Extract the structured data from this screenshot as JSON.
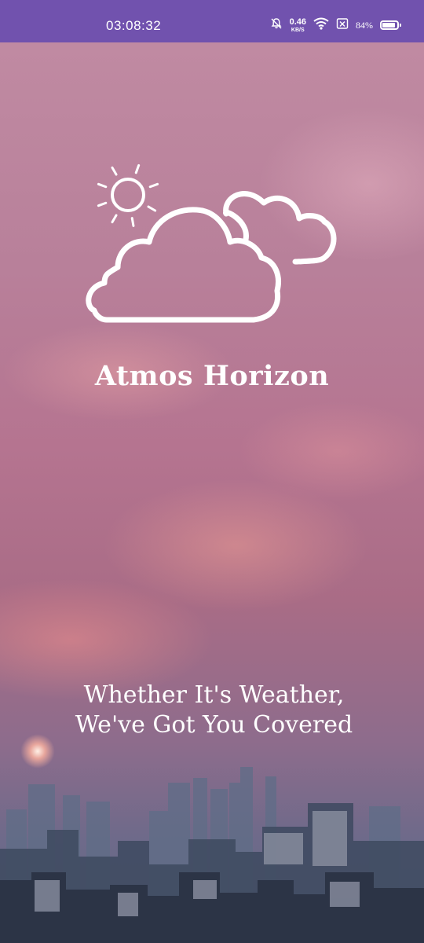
{
  "status_bar": {
    "time": "03:08:32",
    "net_speed_value": "0.46",
    "net_speed_unit": "KB/S",
    "battery_percent": "84%",
    "icons": [
      "bell-off-icon",
      "wifi-icon",
      "sim-off-icon",
      "battery-icon"
    ]
  },
  "splash": {
    "app_name": "Atmos Horizon",
    "tagline_line1": "Whether It's Weather,",
    "tagline_line2": "We've Got You Covered",
    "logo_icon": "sun-behind-clouds-icon"
  },
  "colors": {
    "status_bar": "#7152ae",
    "text": "#ffffff"
  }
}
